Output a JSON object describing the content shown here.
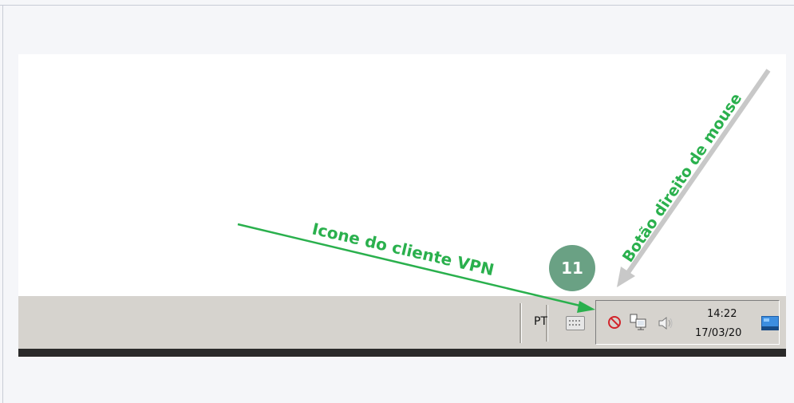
{
  "taskbar": {
    "language": "PT",
    "clock_time": "14:22",
    "clock_date": "17/03/20"
  },
  "annotations": {
    "vpn_label": "Icone do cliente VPN",
    "right_click_label": "Botão direito de mouse",
    "step_badge": "11"
  },
  "colors": {
    "arrow_green": "#2ab04d",
    "arrow_gray": "#c8c8c8",
    "badge": "#6aa184",
    "taskbar": "#d6d3ce"
  }
}
